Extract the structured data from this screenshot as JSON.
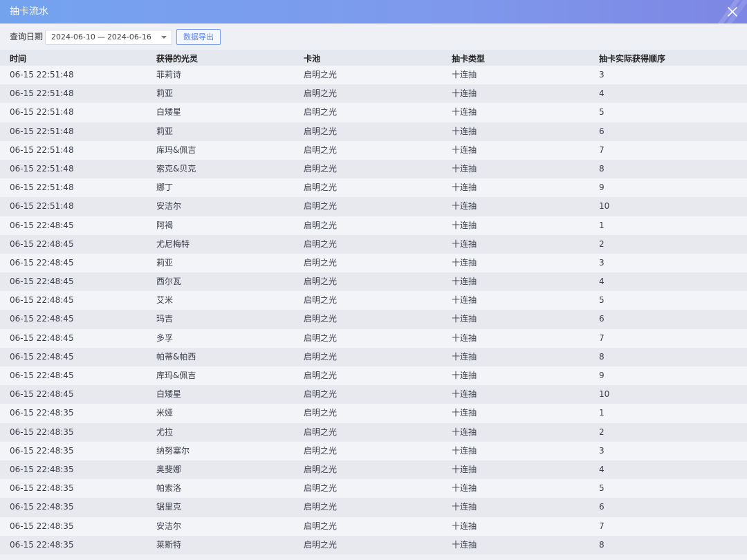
{
  "window": {
    "title": "抽卡流水",
    "accent_color": "#7a9ae9",
    "close_icon": "close-icon"
  },
  "toolbar": {
    "date_label": "查询日期",
    "date_start": "2024-06-10",
    "date_sep": "—",
    "date_end": "2024-06-16",
    "export_label": "数据导出"
  },
  "table": {
    "columns": [
      "时间",
      "获得的光灵",
      "卡池",
      "抽卡类型",
      "抽卡实际获得顺序"
    ],
    "rows": [
      [
        "06-15 22:51:48",
        "菲莉诗",
        "启明之光",
        "十连抽",
        "3"
      ],
      [
        "06-15 22:51:48",
        "莉亚",
        "启明之光",
        "十连抽",
        "4"
      ],
      [
        "06-15 22:51:48",
        "白矮星",
        "启明之光",
        "十连抽",
        "5"
      ],
      [
        "06-15 22:51:48",
        "莉亚",
        "启明之光",
        "十连抽",
        "6"
      ],
      [
        "06-15 22:51:48",
        "库玛&佩吉",
        "启明之光",
        "十连抽",
        "7"
      ],
      [
        "06-15 22:51:48",
        "索克&贝克",
        "启明之光",
        "十连抽",
        "8"
      ],
      [
        "06-15 22:51:48",
        "娜丁",
        "启明之光",
        "十连抽",
        "9"
      ],
      [
        "06-15 22:51:48",
        "安洁尔",
        "启明之光",
        "十连抽",
        "10"
      ],
      [
        "06-15 22:48:45",
        "阿褐",
        "启明之光",
        "十连抽",
        "1"
      ],
      [
        "06-15 22:48:45",
        "尤尼梅特",
        "启明之光",
        "十连抽",
        "2"
      ],
      [
        "06-15 22:48:45",
        "莉亚",
        "启明之光",
        "十连抽",
        "3"
      ],
      [
        "06-15 22:48:45",
        "西尔瓦",
        "启明之光",
        "十连抽",
        "4"
      ],
      [
        "06-15 22:48:45",
        "艾米",
        "启明之光",
        "十连抽",
        "5"
      ],
      [
        "06-15 22:48:45",
        "玛吉",
        "启明之光",
        "十连抽",
        "6"
      ],
      [
        "06-15 22:48:45",
        "多孚",
        "启明之光",
        "十连抽",
        "7"
      ],
      [
        "06-15 22:48:45",
        "帕蒂&帕西",
        "启明之光",
        "十连抽",
        "8"
      ],
      [
        "06-15 22:48:45",
        "库玛&佩吉",
        "启明之光",
        "十连抽",
        "9"
      ],
      [
        "06-15 22:48:45",
        "白矮星",
        "启明之光",
        "十连抽",
        "10"
      ],
      [
        "06-15 22:48:35",
        "米娅",
        "启明之光",
        "十连抽",
        "1"
      ],
      [
        "06-15 22:48:35",
        "尤拉",
        "启明之光",
        "十连抽",
        "2"
      ],
      [
        "06-15 22:48:35",
        "纳努塞尔",
        "启明之光",
        "十连抽",
        "3"
      ],
      [
        "06-15 22:48:35",
        "奥斐娜",
        "启明之光",
        "十连抽",
        "4"
      ],
      [
        "06-15 22:48:35",
        "帕索洛",
        "启明之光",
        "十连抽",
        "5"
      ],
      [
        "06-15 22:48:35",
        "锯里克",
        "启明之光",
        "十连抽",
        "6"
      ],
      [
        "06-15 22:48:35",
        "安洁尔",
        "启明之光",
        "十连抽",
        "7"
      ],
      [
        "06-15 22:48:35",
        "莱斯特",
        "启明之光",
        "十连抽",
        "8"
      ]
    ]
  }
}
